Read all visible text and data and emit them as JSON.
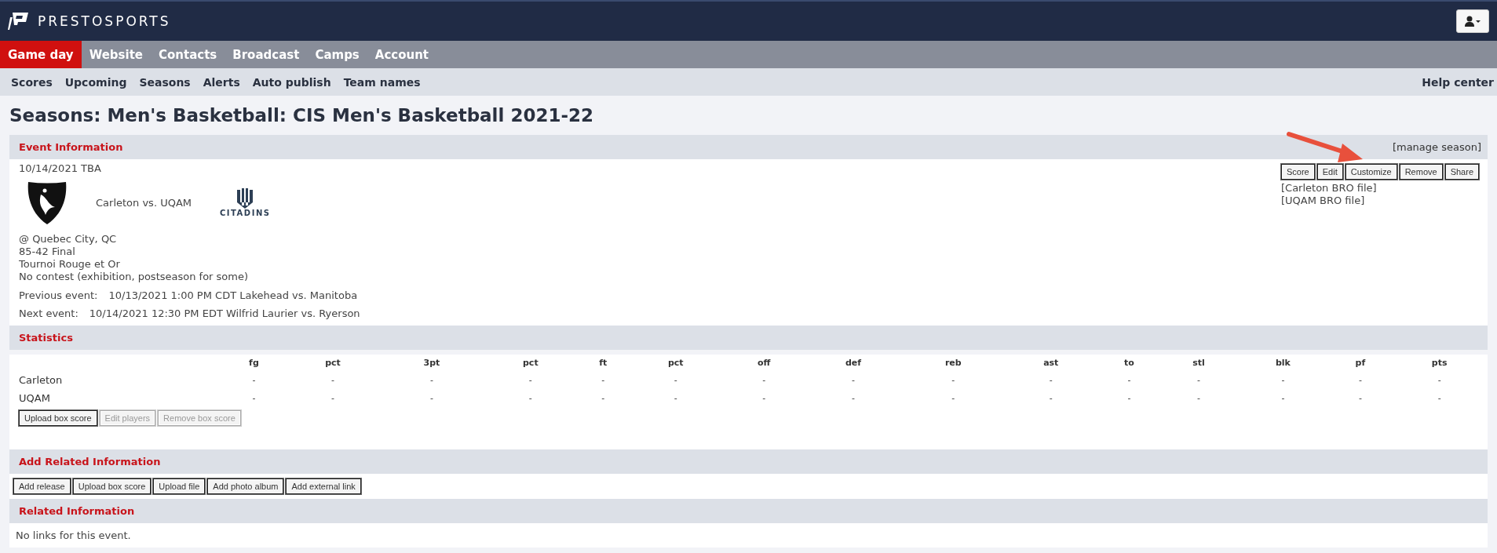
{
  "brand": {
    "name": "PRESTOSPORTS"
  },
  "main_nav": [
    {
      "label": "Game day",
      "selected": true
    },
    {
      "label": "Website",
      "selected": false
    },
    {
      "label": "Contacts",
      "selected": false
    },
    {
      "label": "Broadcast",
      "selected": false
    },
    {
      "label": "Camps",
      "selected": false
    },
    {
      "label": "Account",
      "selected": false
    }
  ],
  "sub_nav": [
    "Scores",
    "Upcoming",
    "Seasons",
    "Alerts",
    "Auto publish",
    "Team names"
  ],
  "help": "Help center",
  "page_title": "Seasons: Men's Basketball: CIS Men's Basketball 2021-22",
  "event_info": {
    "heading": "Event Information",
    "manage": "[manage season]",
    "date": "10/14/2021 TBA",
    "matchup": "Carleton vs. UQAM",
    "away_logo_text": "CITADINS",
    "details": [
      "@ Quebec City, QC",
      "85-42 Final",
      "Tournoi Rouge et Or",
      "No contest (exhibition, postseason for some)"
    ],
    "links": [
      {
        "label": "Previous event:",
        "value": "10/13/2021 1:00 PM CDT Lakehead vs. Manitoba"
      },
      {
        "label": "Next event:",
        "value": "10/14/2021 12:30 PM EDT Wilfrid Laurier vs. Ryerson"
      }
    ],
    "actions": [
      "Score",
      "Edit",
      "Customize",
      "Remove",
      "Share"
    ],
    "files": [
      "[Carleton BRO file]",
      "[UQAM BRO file]"
    ]
  },
  "statistics": {
    "heading": "Statistics",
    "columns": [
      "fg",
      "pct",
      "3pt",
      "pct",
      "ft",
      "pct",
      "off",
      "def",
      "reb",
      "ast",
      "to",
      "stl",
      "blk",
      "pf",
      "pts"
    ],
    "rows": [
      {
        "team": "Carleton",
        "values": [
          "-",
          "-",
          "-",
          "-",
          "-",
          "-",
          "-",
          "-",
          "-",
          "-",
          "-",
          "-",
          "-",
          "-",
          "-"
        ]
      },
      {
        "team": "UQAM",
        "values": [
          "-",
          "-",
          "-",
          "-",
          "-",
          "-",
          "-",
          "-",
          "-",
          "-",
          "-",
          "-",
          "-",
          "-",
          "-"
        ]
      }
    ],
    "buttons": [
      {
        "label": "Upload box score",
        "disabled": false
      },
      {
        "label": "Edit players",
        "disabled": true
      },
      {
        "label": "Remove box score",
        "disabled": true
      }
    ]
  },
  "add_related": {
    "heading": "Add Related Information",
    "buttons": [
      "Add release",
      "Upload box score",
      "Upload file",
      "Add photo album",
      "Add external link"
    ]
  },
  "related": {
    "heading": "Related Information",
    "message": "No links for this event."
  }
}
